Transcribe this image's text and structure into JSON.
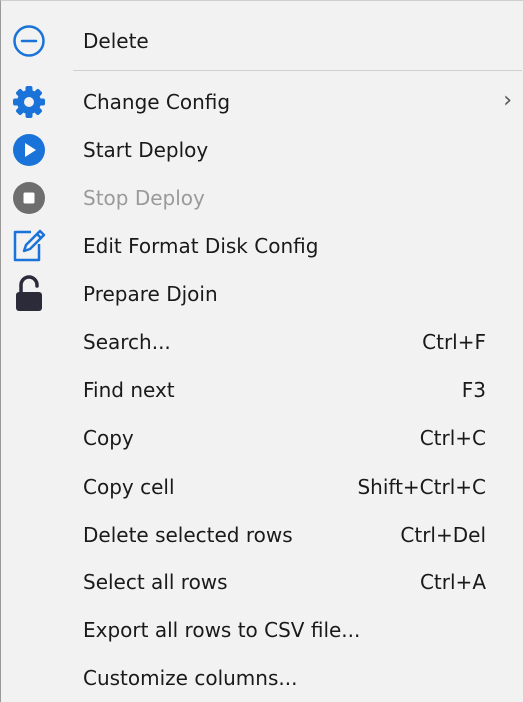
{
  "menu": {
    "items": [
      {
        "label": "Delete",
        "shortcut": "",
        "icon": "minus-circle-icon"
      },
      {
        "label": "Change Config",
        "shortcut": "",
        "icon": "gear-icon",
        "submenu_arrow": "›"
      },
      {
        "label": "Start Deploy",
        "shortcut": "",
        "icon": "play-icon"
      },
      {
        "label": "Stop Deploy",
        "shortcut": "",
        "icon": "stop-icon",
        "disabled": true
      },
      {
        "label": "Edit Format Disk Config",
        "shortcut": "",
        "icon": "edit-icon"
      },
      {
        "label": "Prepare Djoin",
        "shortcut": "",
        "icon": "lock-icon"
      },
      {
        "label": "Search...",
        "shortcut": "Ctrl+F"
      },
      {
        "label": "Find next",
        "shortcut": "F3"
      },
      {
        "label": "Copy",
        "shortcut": "Ctrl+C"
      },
      {
        "label": "Copy cell",
        "shortcut": "Shift+Ctrl+C"
      },
      {
        "label": "Delete selected rows",
        "shortcut": "Ctrl+Del"
      },
      {
        "label": "Select all rows",
        "shortcut": "Ctrl+A"
      },
      {
        "label": "Export all rows to CSV file...",
        "shortcut": ""
      },
      {
        "label": "Customize columns...",
        "shortcut": ""
      }
    ]
  },
  "colors": {
    "menu_background": "#f2f2f2",
    "accent_blue": "#1a73d9",
    "stop_gray": "#6e6e6e",
    "lock_dark": "#2b2b3a",
    "disabled_text": "#9a9a9a"
  }
}
